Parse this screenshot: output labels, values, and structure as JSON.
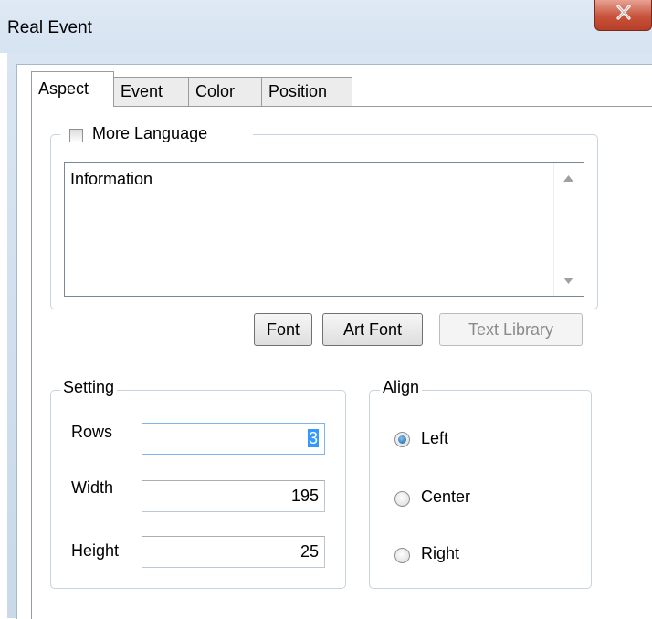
{
  "window": {
    "title": "Real Event"
  },
  "tabs": [
    {
      "label": "Aspect",
      "active": true
    },
    {
      "label": "Event",
      "active": false
    },
    {
      "label": "Color",
      "active": false
    },
    {
      "label": "Position",
      "active": false
    }
  ],
  "aspect": {
    "more_language": {
      "label": "More Language",
      "checked": false
    },
    "text_value": "Information",
    "buttons": {
      "font": "Font",
      "art_font": "Art Font",
      "text_library": "Text Library"
    },
    "setting": {
      "title": "Setting",
      "rows": {
        "label": "Rows",
        "value": "3"
      },
      "width": {
        "label": "Width",
        "value": "195"
      },
      "height": {
        "label": "Height",
        "value": "25"
      }
    },
    "align": {
      "title": "Align",
      "options": [
        "Left",
        "Center",
        "Right"
      ],
      "selected": "Left"
    }
  },
  "colors": {
    "accent": "#3399ff",
    "close_button": "#c7523b"
  },
  "icons": [
    "close-icon",
    "checkbox-icon",
    "scroll-up-arrow-icon",
    "scroll-down-arrow-icon",
    "radio-icon"
  ]
}
